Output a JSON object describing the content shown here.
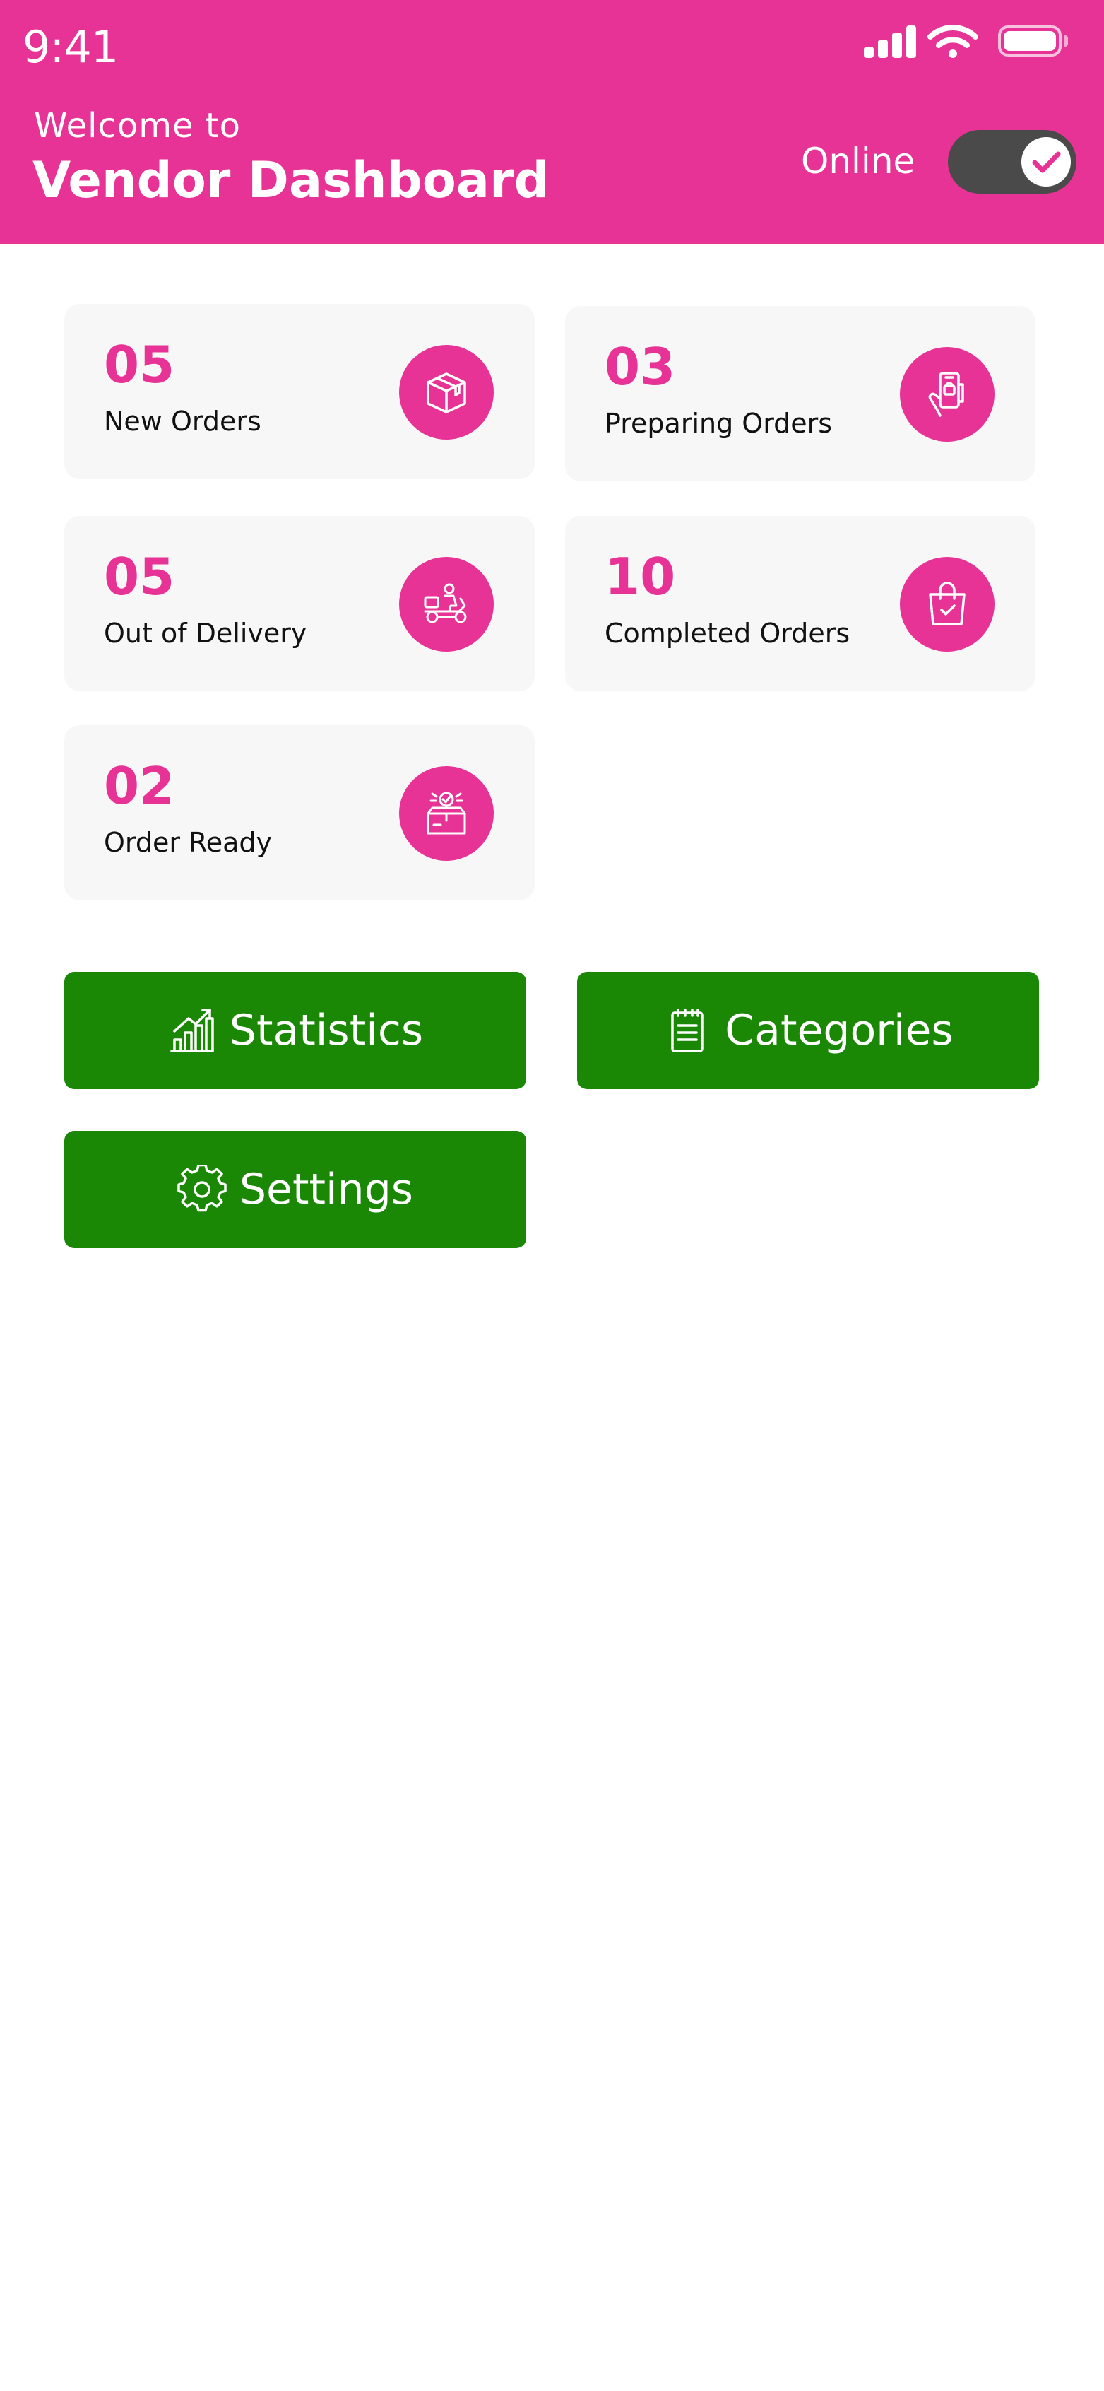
{
  "status_bar": {
    "time": "9:41"
  },
  "header": {
    "welcome": "Welcome to",
    "title": "Vendor Dashboard",
    "online_label": "Online",
    "online_toggle_on": true
  },
  "stats": [
    {
      "count": "05",
      "label": "New Orders",
      "icon": "box-icon"
    },
    {
      "count": "03",
      "label": "Preparing Orders",
      "icon": "phone-order-icon"
    },
    {
      "count": "05",
      "label": "Out of Delivery",
      "icon": "delivery-scooter-icon"
    },
    {
      "count": "10",
      "label": "Completed Orders",
      "icon": "bag-check-icon"
    },
    {
      "count": "02",
      "label": "Order Ready",
      "icon": "package-ready-icon"
    }
  ],
  "buttons": {
    "statistics": "Statistics",
    "categories": "Categories",
    "settings": "Settings"
  },
  "colors": {
    "brand": "#E63395",
    "button": "#1A8705",
    "card_bg": "#F7F7F7",
    "toggle_track": "#4A4A4A"
  }
}
